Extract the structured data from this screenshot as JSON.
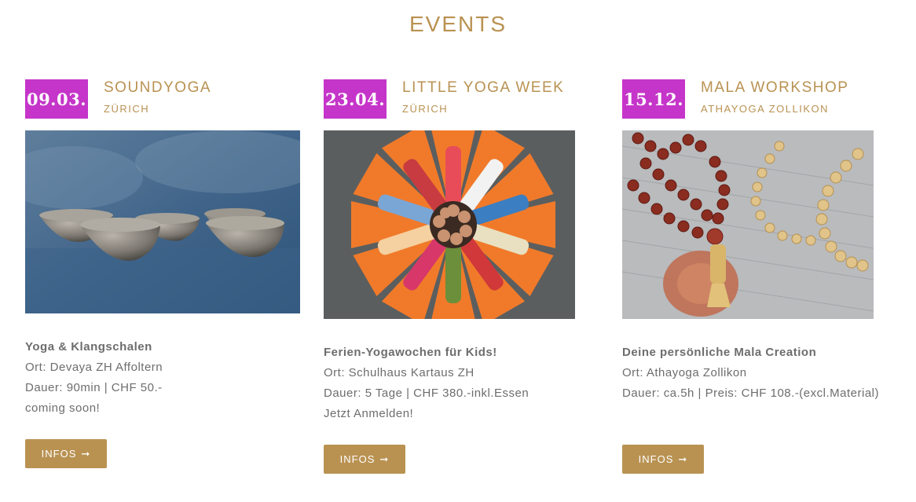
{
  "section_title": "EVENTS",
  "events": [
    {
      "date": "09.03.",
      "title": "SOUNDYOGA",
      "location": "ZÜRICH",
      "headline": "Yoga & Klangschalen",
      "lines": [
        "Ort: Devaya ZH Affoltern",
        "Dauer: 90min | CHF 50.-",
        "coming soon!"
      ],
      "button": "INFOS",
      "image_icon": "singing-bowls-photo"
    },
    {
      "date": "23.04.",
      "title": "LITTLE YOGA WEEK",
      "location": "ZÜRICH",
      "headline": "Ferien-Yogawochen für Kids!",
      "lines": [
        "Ort: Schulhaus Kartaus ZH",
        "Dauer: 5 Tage | CHF 380.-inkl.Essen",
        "Jetzt Anmelden!"
      ],
      "button": "INFOS",
      "image_icon": "kids-yoga-circle-photo"
    },
    {
      "date": "15.12.",
      "title": "MALA WORKSHOP",
      "location": "ATHAYOGA ZOLLIKON",
      "headline": "Deine persönliche Mala Creation",
      "lines": [
        "Ort: Athayoga Zollikon",
        "Dauer: ca.5h | Preis: CHF 108.-(excl.Material)"
      ],
      "button": "INFOS",
      "image_icon": "mala-beads-photo"
    }
  ],
  "colors": {
    "accent": "#b99252",
    "date_badge": "#c535c9",
    "text": "#6d6d6d"
  }
}
